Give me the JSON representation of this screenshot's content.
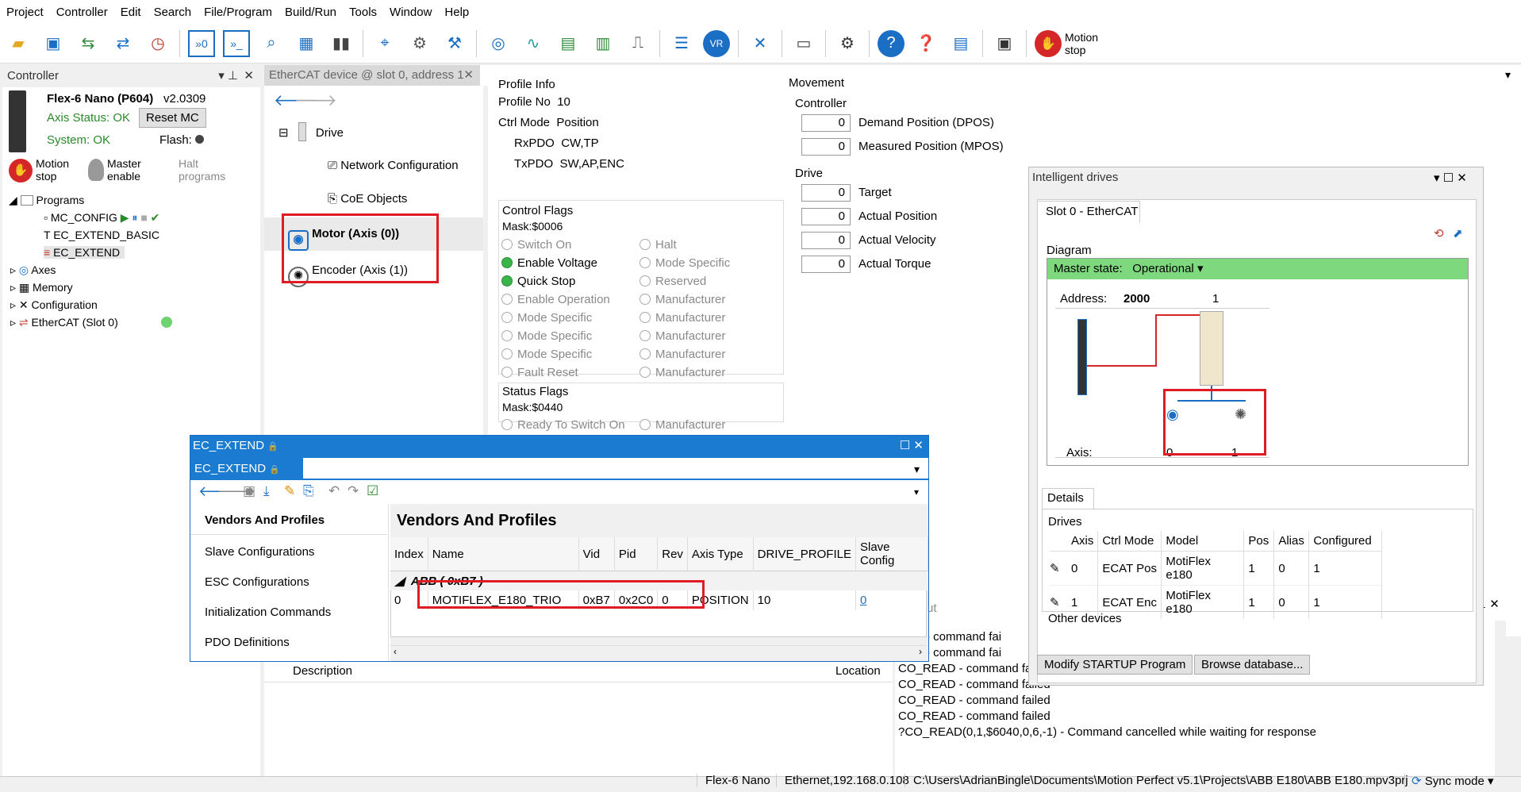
{
  "menu": [
    "Project",
    "Controller",
    "Edit",
    "Search",
    "File/Program",
    "Build/Run",
    "Tools",
    "Window",
    "Help"
  ],
  "toolbar": {
    "motion_stop": "Motion\nstop"
  },
  "controller": {
    "panel_title": "Controller",
    "device_name": "Flex-6 Nano (P604)",
    "version": "v2.0309",
    "axis_status": "Axis Status: OK",
    "reset_label": "Reset MC",
    "system_status": "System: OK",
    "flash_label": "Flash:",
    "motion_stop": "Motion stop",
    "master_enable": "Master enable",
    "halt_programs": "Halt programs",
    "tree": {
      "programs": "Programs",
      "mc_config": "MC_CONFIG",
      "ec_extend_basic": "EC_EXTEND_BASIC",
      "ec_extend": "EC_EXTEND",
      "axes": "Axes",
      "memory": "Memory",
      "configuration": "Configuration",
      "ethercat": "EtherCAT (Slot 0)"
    }
  },
  "ethercat_tab": {
    "title": "EtherCAT device @ slot 0, address 1",
    "nav": {
      "drive": "Drive",
      "network": "Network Configuration",
      "coe": "CoE Objects",
      "motor": "Motor (Axis (0))",
      "encoder": "Encoder (Axis (1))"
    },
    "profile_info": {
      "heading": "Profile Info",
      "profile_no_label": "Profile No",
      "profile_no": "10",
      "ctrl_mode_label": "Ctrl Mode",
      "ctrl_mode": "Position",
      "rxpdo_label": "RxPDO",
      "rxpdo": "CW,TP",
      "txpdo_label": "TxPDO",
      "txpdo": "SW,AP,ENC"
    },
    "control_flags": {
      "heading": "Control Flags",
      "mask": "Mask:$0006",
      "left": [
        "Switch On",
        "Enable Voltage",
        "Quick Stop",
        "Enable Operation",
        "Mode Specific",
        "Mode Specific",
        "Mode Specific",
        "Fault Reset"
      ],
      "right": [
        "Halt",
        "Mode Specific",
        "Reserved",
        "Manufacturer",
        "Manufacturer",
        "Manufacturer",
        "Manufacturer",
        "Manufacturer"
      ]
    },
    "status_flags": {
      "heading": "Status Flags",
      "mask": "Mask:$0440",
      "first": "Ready To Switch On",
      "first_right": "Manufacturer"
    },
    "movement": {
      "heading": "Movement",
      "controller": "Controller",
      "drive": "Drive",
      "rows": [
        {
          "value": "0",
          "label": "Demand Position (DPOS)"
        },
        {
          "value": "0",
          "label": "Measured Position (MPOS)"
        },
        {
          "value": "0",
          "label": "Target"
        },
        {
          "value": "0",
          "label": "Actual Position"
        },
        {
          "value": "0",
          "label": "Actual Velocity"
        },
        {
          "value": "0",
          "label": "Actual Torque"
        }
      ]
    }
  },
  "intelligent": {
    "title": "Intelligent drives",
    "tab": "Slot 0 - EtherCAT",
    "diagram_label": "Diagram",
    "master_state_label": "Master state:",
    "master_state": "Operational",
    "address_label": "Address:",
    "address": "2000",
    "address_num": "1",
    "axis_label": "Axis:",
    "axis0": "0",
    "axis1": "1",
    "details_tab": "Details",
    "drives_label": "Drives",
    "columns": [
      "Axis",
      "Ctrl Mode",
      "Model",
      "Pos",
      "Alias",
      "Configured"
    ],
    "rows": [
      [
        "0",
        "ECAT Pos",
        "MotiFlex e180",
        "1",
        "0",
        "1"
      ],
      [
        "1",
        "ECAT Enc",
        "MotiFlex e180",
        "1",
        "0",
        "1"
      ]
    ],
    "other_devices": "Other devices",
    "modify_btn": "Modify STARTUP Program",
    "browse_btn": "Browse database..."
  },
  "ecext": {
    "title": "EC_EXTEND",
    "tab": "EC_EXTEND",
    "sidebar": [
      "Vendors And Profiles",
      "Slave Configurations",
      "ESC Configurations",
      "Initialization Commands",
      "PDO Definitions"
    ],
    "heading": "Vendors And Profiles",
    "columns": [
      "Index",
      "Name",
      "Vid",
      "Pid",
      "Rev",
      "Axis Type",
      "DRIVE_PROFILE",
      "Slave Config"
    ],
    "group": "ABB ( 0xB7 )",
    "row": [
      "0",
      "MOTIFLEX_E180_TRIO",
      "0xB7",
      "0x2C0",
      "0",
      "POSITION",
      "10",
      "0"
    ]
  },
  "bottom": {
    "description": "Description",
    "location": "Location"
  },
  "output": {
    "lines": [
      "EAD - command fai",
      "EAD - command fai",
      "CO_READ - command fai",
      "CO_READ - command failed",
      "CO_READ - command failed",
      "CO_READ - command failed",
      "?CO_READ(0,1,$6040,0,6,-1) - Command cancelled while waiting for response"
    ],
    "title_frag": "ut"
  },
  "status": {
    "device": "Flex-6 Nano",
    "connection": "Ethernet,192.168.0.108",
    "path": "C:\\Users\\AdrianBingle\\Documents\\Motion Perfect v5.1\\Projects\\ABB E180\\ABB E180.mpv3prj",
    "sync": "Sync mode"
  }
}
